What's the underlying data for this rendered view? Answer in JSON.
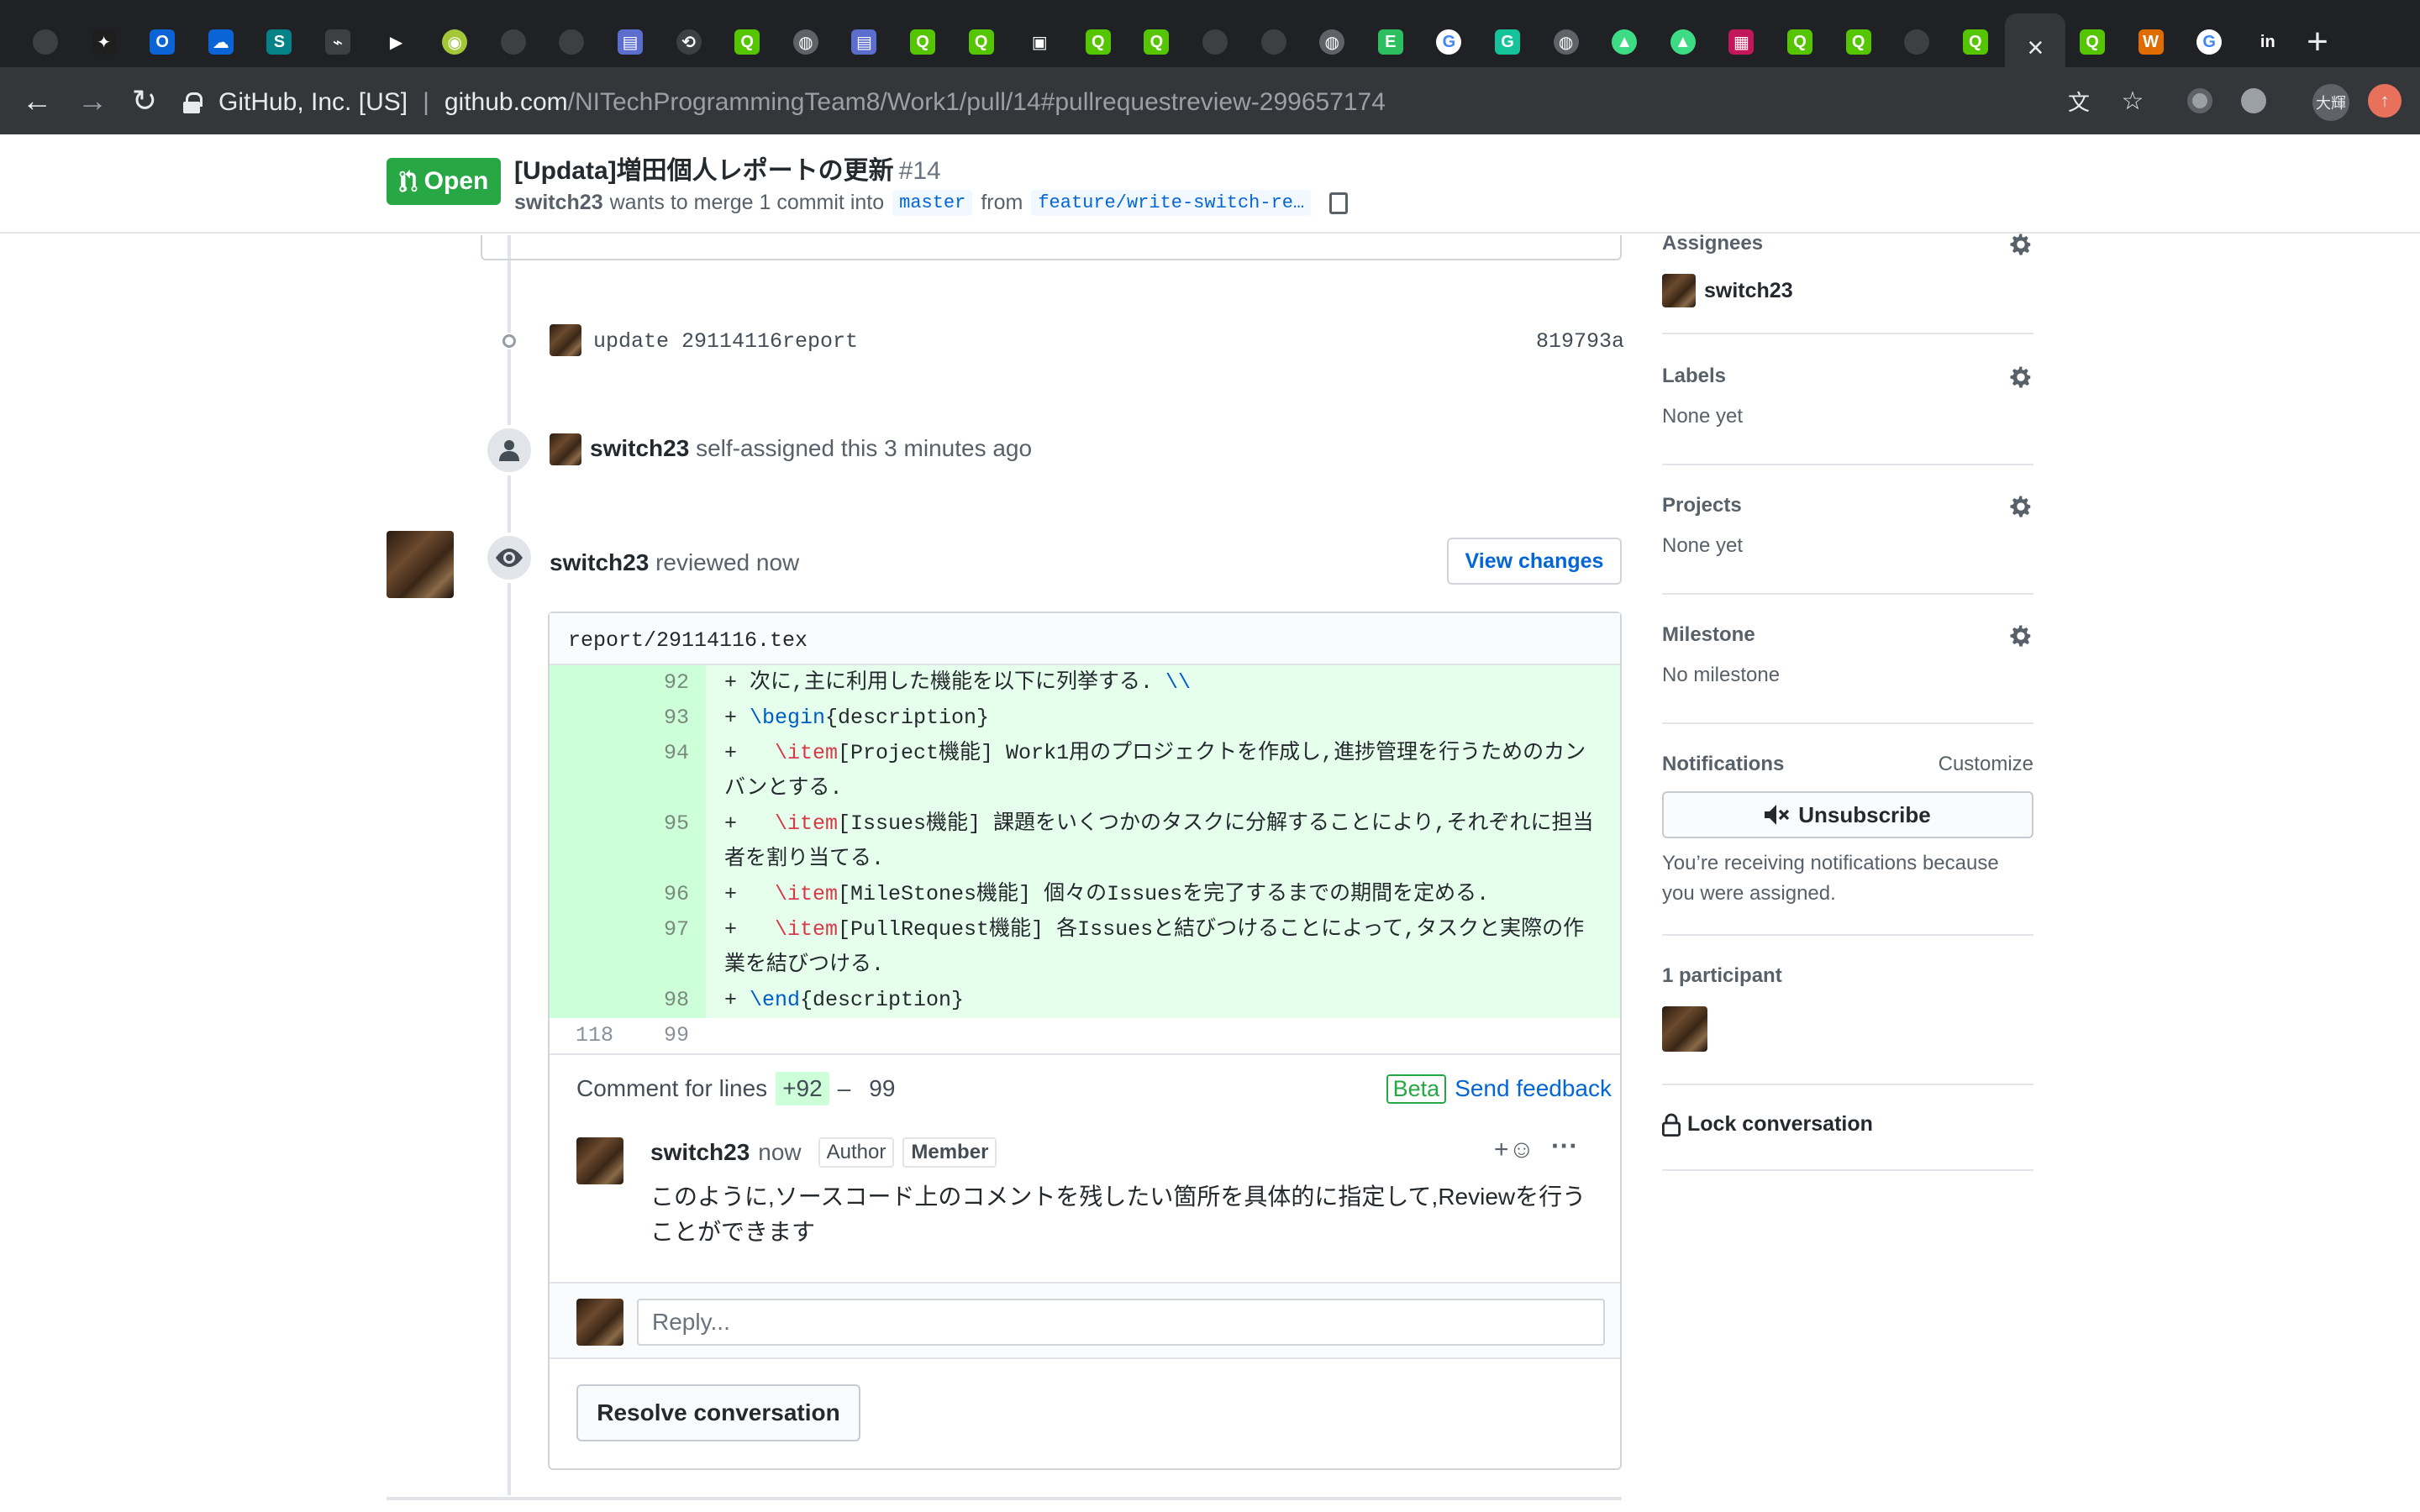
{
  "browser": {
    "tabs": [
      {
        "icon": "github-icon",
        "color": "#3c4043",
        "glyph": ""
      },
      {
        "icon": "app-icon",
        "color": "#1e1e1e",
        "glyph": "✦"
      },
      {
        "icon": "outlook-icon",
        "color": "#0a64d6",
        "glyph": "O"
      },
      {
        "icon": "onedrive-icon",
        "color": "#0a64d6",
        "glyph": "☁"
      },
      {
        "icon": "sharepoint-icon",
        "color": "#038387",
        "glyph": "S"
      },
      {
        "icon": "app-icon",
        "color": "#3c4043",
        "glyph": "⌁"
      },
      {
        "icon": "play-store-icon",
        "color": "#202124",
        "glyph": "▶"
      },
      {
        "icon": "android-icon",
        "color": "#a4c639",
        "glyph": "◉"
      },
      {
        "icon": "github-icon",
        "color": "#3c4043",
        "glyph": ""
      },
      {
        "icon": "github-icon",
        "color": "#3c4043",
        "glyph": ""
      },
      {
        "icon": "app-icon",
        "color": "#5b6dcd",
        "glyph": "▤"
      },
      {
        "icon": "history-icon",
        "color": "#3c4043",
        "glyph": "⟲"
      },
      {
        "icon": "qiita-icon",
        "color": "#55c500",
        "glyph": "Q"
      },
      {
        "icon": "globe-icon",
        "color": "#5f6368",
        "glyph": "◍"
      },
      {
        "icon": "app-icon",
        "color": "#5b6dcd",
        "glyph": "▤"
      },
      {
        "icon": "qiita-icon",
        "color": "#55c500",
        "glyph": "Q"
      },
      {
        "icon": "qiita-icon",
        "color": "#55c500",
        "glyph": "Q"
      },
      {
        "icon": "app-icon",
        "color": "#202124",
        "glyph": "▣"
      },
      {
        "icon": "qiita-icon",
        "color": "#55c500",
        "glyph": "Q"
      },
      {
        "icon": "qiita-icon",
        "color": "#55c500",
        "glyph": "Q"
      },
      {
        "icon": "github-icon",
        "color": "#3c4043",
        "glyph": ""
      },
      {
        "icon": "github-icon",
        "color": "#3c4043",
        "glyph": ""
      },
      {
        "icon": "globe-icon",
        "color": "#5f6368",
        "glyph": "◍"
      },
      {
        "icon": "evernote-icon",
        "color": "#2dbe60",
        "glyph": "E"
      },
      {
        "icon": "google-icon",
        "color": "#ffffff",
        "glyph": "G"
      },
      {
        "icon": "grammarly-icon",
        "color": "#15c39a",
        "glyph": "G"
      },
      {
        "icon": "globe-icon",
        "color": "#5f6368",
        "glyph": "◍"
      },
      {
        "icon": "android-icon",
        "color": "#3ddc84",
        "glyph": "▲"
      },
      {
        "icon": "android-icon",
        "color": "#3ddc84",
        "glyph": "▲"
      },
      {
        "icon": "app-icon",
        "color": "#c2185b",
        "glyph": "▦"
      },
      {
        "icon": "qiita-icon",
        "color": "#55c500",
        "glyph": "Q"
      },
      {
        "icon": "qiita-icon",
        "color": "#55c500",
        "glyph": "Q"
      },
      {
        "icon": "github-icon",
        "color": "#3c4043",
        "glyph": ""
      },
      {
        "icon": "qiita-icon",
        "color": "#55c500",
        "glyph": "Q"
      },
      {
        "icon": "close-icon",
        "color": "active",
        "glyph": "×"
      },
      {
        "icon": "qiita-icon",
        "color": "#55c500",
        "glyph": "Q"
      },
      {
        "icon": "word-icon",
        "color": "#e06c00",
        "glyph": "W"
      },
      {
        "icon": "google-icon",
        "color": "#ffffff",
        "glyph": "G"
      },
      {
        "icon": "invision-icon",
        "color": "#202124",
        "glyph": "in"
      }
    ],
    "site_identity": "GitHub, Inc. [US]",
    "url_host": "github.com",
    "url_path": "/NITechProgrammingTeam8/Work1/pull/14#pullrequestreview-299657174",
    "profile_label": "大輝"
  },
  "pr": {
    "state": "Open",
    "title": "[Updata]増田個人レポートの更新",
    "number": "#14",
    "author": "switch23",
    "merge_text": "wants to merge 1 commit into",
    "base_branch": "master",
    "from_text": "from",
    "head_branch": "feature/write-switch-re…"
  },
  "timeline": {
    "commit": {
      "message": "update 29114116report",
      "sha": "819793a"
    },
    "assign_event": {
      "actor": "switch23",
      "text": "self-assigned this 3 minutes ago"
    },
    "review": {
      "actor": "switch23",
      "text": "reviewed now",
      "view_changes_label": "View changes",
      "file": "report/29114116.tex"
    }
  },
  "diff": [
    {
      "old": "",
      "new": "92",
      "type": "add",
      "parts": [
        [
          "+ 次に,主に利用した機能を以下に列挙する. ",
          ""
        ],
        [
          "\\\\",
          "blue"
        ]
      ]
    },
    {
      "old": "",
      "new": "93",
      "type": "add",
      "parts": [
        [
          "+ ",
          ""
        ],
        [
          "\\begin",
          "blue"
        ],
        [
          "{description}",
          ""
        ]
      ]
    },
    {
      "old": "",
      "new": "94",
      "type": "add",
      "tall": true,
      "parts": [
        [
          "+   ",
          ""
        ],
        [
          "\\item",
          "red"
        ],
        [
          "[Project機能] Work1用のプロジェクトを作成し,進捗管理を行うためのカンバンとする.",
          ""
        ]
      ]
    },
    {
      "old": "",
      "new": "95",
      "type": "add",
      "tall": true,
      "parts": [
        [
          "+   ",
          ""
        ],
        [
          "\\item",
          "red"
        ],
        [
          "[Issues機能] 課題をいくつかのタスクに分解することにより,それぞれに担当者を割り当てる.",
          ""
        ]
      ]
    },
    {
      "old": "",
      "new": "96",
      "type": "add",
      "parts": [
        [
          "+   ",
          ""
        ],
        [
          "\\item",
          "red"
        ],
        [
          "[MileStones機能] 個々のIssuesを完了するまでの期間を定める.",
          ""
        ]
      ]
    },
    {
      "old": "",
      "new": "97",
      "type": "add",
      "tall": true,
      "parts": [
        [
          "+   ",
          ""
        ],
        [
          "\\item",
          "red"
        ],
        [
          "[PullRequest機能] 各Issuesと結びつけることによって,タスクと実際の作業を結びつける.",
          ""
        ]
      ]
    },
    {
      "old": "",
      "new": "98",
      "type": "add",
      "parts": [
        [
          "+ ",
          ""
        ],
        [
          "\\end",
          "blue"
        ],
        [
          "{description}",
          ""
        ]
      ]
    },
    {
      "old": "118",
      "new": "99",
      "type": "ctx",
      "parts": [
        [
          "",
          ""
        ]
      ]
    }
  ],
  "comment": {
    "lines_label": "Comment for lines",
    "line_start": "+92",
    "line_dash": "–",
    "line_end": "99",
    "beta": "Beta",
    "send_feedback": "Send feedback",
    "author": "switch23",
    "time": "now",
    "badge_author": "Author",
    "badge_member": "Member",
    "reaction": "+☺",
    "more": "···",
    "body": "このように,ソースコード上のコメントを残したい箇所を具体的に指定して,Reviewを行うことができます",
    "reply_placeholder": "Reply...",
    "resolve_label": "Resolve conversation"
  },
  "sidebar": {
    "assignees": {
      "title": "Assignees",
      "value": "switch23"
    },
    "labels": {
      "title": "Labels",
      "value": "None yet"
    },
    "projects": {
      "title": "Projects",
      "value": "None yet"
    },
    "milestone": {
      "title": "Milestone",
      "value": "No milestone"
    },
    "notifications": {
      "title": "Notifications",
      "customize": "Customize",
      "unsubscribe": "Unsubscribe",
      "reason": "You’re receiving notifications because you were assigned."
    },
    "participants": {
      "title": "1 participant"
    },
    "lock": {
      "label": "Lock conversation"
    }
  }
}
